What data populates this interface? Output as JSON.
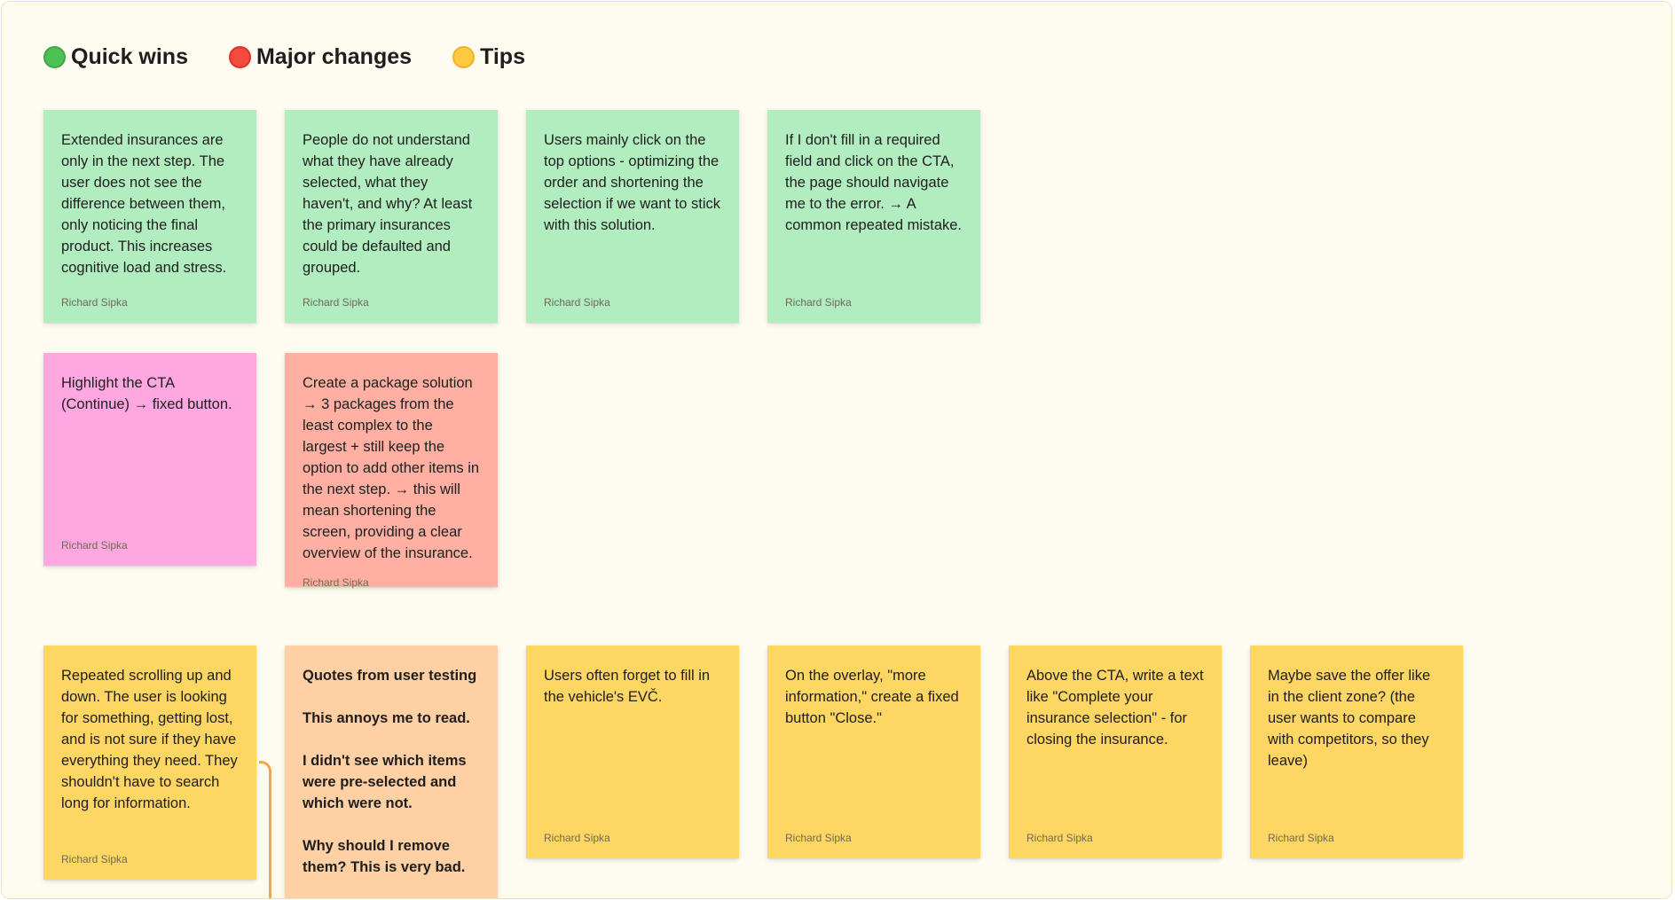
{
  "colors": {
    "background": "#fefbf0",
    "green_note": "#b2edbf",
    "pink_note": "#ffa7e0",
    "salmon_note": "#ffb0a2",
    "yellow_note": "#fed663",
    "peach_note": "#fed0a4",
    "green_dot": "#4ec156",
    "red_dot": "#f44a3e",
    "yellow_dot": "#fec93f"
  },
  "legend": [
    {
      "label": "Quick wins",
      "icon": "green-circle-icon",
      "color": "#4ec156"
    },
    {
      "label": "Major changes",
      "icon": "red-circle-icon",
      "color": "#f44a3e"
    },
    {
      "label": "Tips",
      "icon": "yellow-circle-icon",
      "color": "#fec93f"
    }
  ],
  "notes": [
    {
      "text": "Extended insurances are only in the next step. The user does not see the difference between them, only noticing the final product. This increases cognitive load and stress.",
      "author": "Richard Sipka",
      "color": "#b2edbf"
    },
    {
      "text": "People do not understand what they have already selected, what they haven't, and why? At least the primary insurances could be defaulted and grouped.",
      "author": "Richard Sipka",
      "color": "#b2edbf"
    },
    {
      "text": "Users mainly click on the top options - optimizing the order and shortening the selection if we want to stick with this solution.",
      "author": "Richard Sipka",
      "color": "#b2edbf"
    },
    {
      "text": "If I don't fill in a required field and click on the CTA, the page should navigate me to the error. → A common repeated mistake.",
      "author": "Richard Sipka",
      "color": "#b2edbf"
    },
    {
      "text": "Highlight the CTA (Continue) → fixed button.",
      "author": "Richard Sipka",
      "color": "#ffa7e0"
    },
    {
      "text": "Create a package solution → 3 packages from the least complex to the largest + still keep the option to add other items in the next step. → this will mean shortening the screen, providing a clear overview of the insurance.",
      "author": "Richard Sipka",
      "color": "#ffb0a2"
    },
    {
      "text": "Repeated scrolling up and down. The user is looking for something, getting lost, and is not sure if they have everything they need. They shouldn't have to search long for information.",
      "author": "Richard Sipka",
      "color": "#fed663"
    },
    {
      "text": "Quotes from user testing\n\nThis annoys me to read.\n\nI didn't see which items were pre-selected and which were not.\n\nWhy should I remove them? This is very bad.",
      "author": "",
      "color": "#fed0a4",
      "bold": true
    },
    {
      "text": "Users often forget to fill in the vehicle's EVČ.",
      "author": "Richard Sipka",
      "color": "#fed663"
    },
    {
      "text": "On the overlay, \"more information,\" create a fixed button \"Close.\"",
      "author": "Richard Sipka",
      "color": "#fed663"
    },
    {
      "text": "Above the CTA, write a text like \"Complete your insurance selection\" - for closing the insurance.",
      "author": "Richard Sipka",
      "color": "#fed663"
    },
    {
      "text": "Maybe save the offer like in the client zone? (the user wants to compare with competitors, so they leave)",
      "author": "Richard Sipka",
      "color": "#fed663"
    }
  ]
}
